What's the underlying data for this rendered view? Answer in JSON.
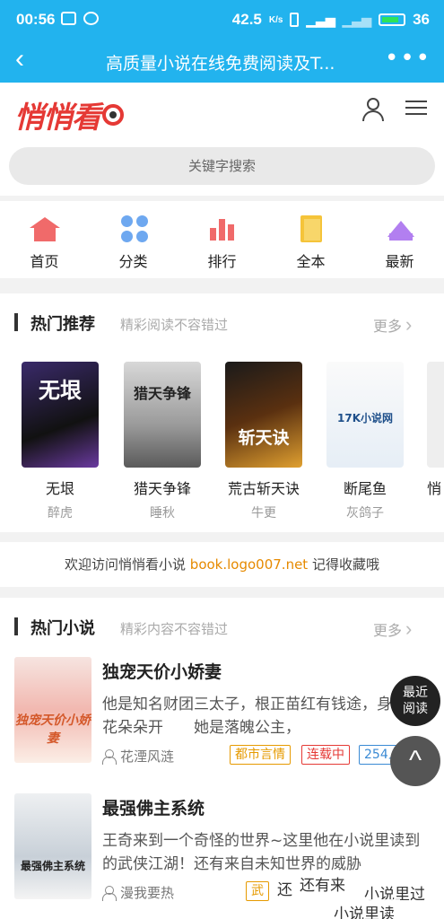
{
  "status": {
    "time": "00:56",
    "speed": "42.5",
    "speed_unit": "K/s",
    "battery": "36"
  },
  "titlebar": {
    "back": "‹",
    "title": "高质量小说在线免费阅读及T...",
    "more": "•••"
  },
  "header": {
    "logo": "悄悄看"
  },
  "search": {
    "placeholder": "关键字搜索"
  },
  "nav": [
    {
      "label": "首页",
      "icon": "home-icon"
    },
    {
      "label": "分类",
      "icon": "category-icon"
    },
    {
      "label": "排行",
      "icon": "rank-icon"
    },
    {
      "label": "全本",
      "icon": "book-icon"
    },
    {
      "label": "最新",
      "icon": "crown-icon"
    }
  ],
  "hot_recommend": {
    "title": "热门推荐",
    "subtitle": "精彩阅读不容错过",
    "more": "更多",
    "books": [
      {
        "name": "无垠",
        "author": "醉虎",
        "cover_text": "无垠"
      },
      {
        "name": "猎天争锋",
        "author": "睡秋",
        "cover_text": "猎天争锋"
      },
      {
        "name": "荒古斩天诀",
        "author": "牛更",
        "cover_text": "斩天诀"
      },
      {
        "name": "断尾鱼",
        "author": "灰鸽子",
        "cover_text": "17K小说网"
      },
      {
        "name": "悄",
        "author": "",
        "cover_text": ""
      }
    ]
  },
  "welcome": {
    "prefix": "欢迎访问悄悄看小说 ",
    "url": "book.logo007.net",
    "suffix": " 记得收藏哦"
  },
  "hot_novels": {
    "title": "热门小说",
    "subtitle": "精彩内容不容错过",
    "more": "更多",
    "items": [
      {
        "title": "独宠天价小娇妻",
        "desc": "他是知名财团三太子，根正苗红有钱途，身边桃花朵朵开　　她是落魄公主，",
        "author": "花湮风涟",
        "tags": [
          "都市言情",
          "连载中",
          "254人看过"
        ],
        "cover_text": "独宠天价小娇妻"
      },
      {
        "title": "最强佛主系统",
        "desc": "王奇来到一个奇怪的世界~这里他在小说里读到的武侠江湖！还有来自未知世界的威胁",
        "author": "漫我要热",
        "tags": [
          "武",
          "还"
        ],
        "cover_text": "最强佛主系统"
      }
    ]
  },
  "float": {
    "recent_line1": "最近",
    "recent_line2": "阅读",
    "top": "^"
  },
  "toasts": [
    "还有来",
    "小说里过",
    "小说里读"
  ],
  "colors": {
    "primary": "#22b3ee",
    "logo": "#e53935",
    "url": "#e68a00"
  }
}
